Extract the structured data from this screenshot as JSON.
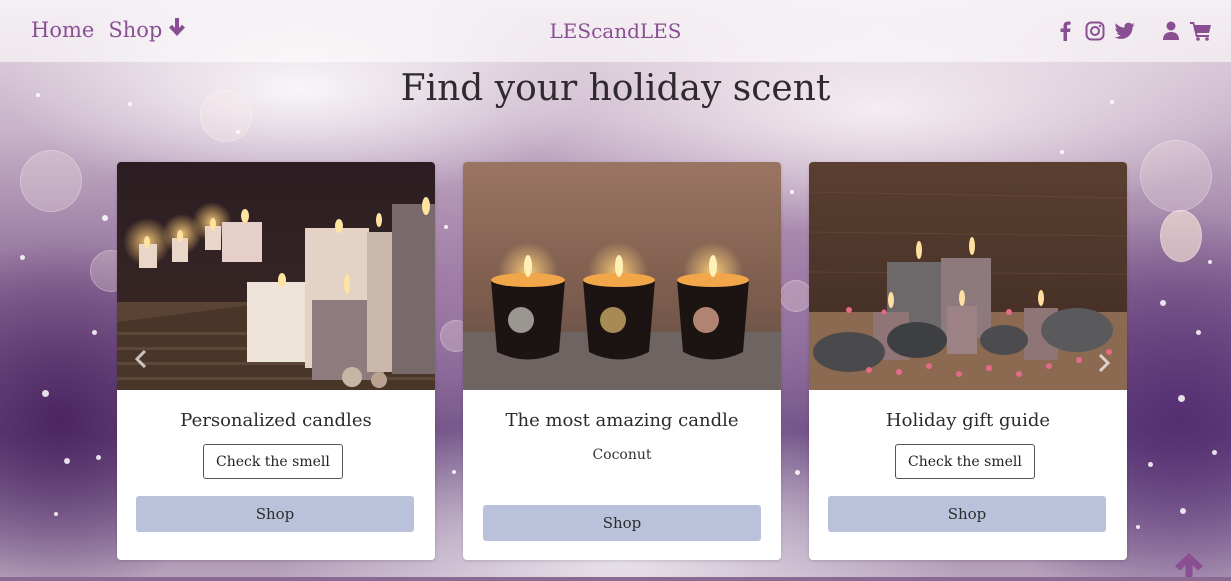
{
  "nav": {
    "home_label": "Home",
    "shop_label": "Shop",
    "brand": "LEScandLES",
    "icons": [
      "facebook-icon",
      "instagram-icon",
      "twitter-icon",
      "user-icon",
      "cart-icon"
    ]
  },
  "hero": {
    "title": "Find your holiday scent"
  },
  "cards": [
    {
      "title": "Personalized candles",
      "smell_button": "Check the smell",
      "shop_button": "Shop"
    },
    {
      "title": "The most amazing candle",
      "subtitle": "Coconut",
      "shop_button": "Shop"
    },
    {
      "title": "Holiday gift guide",
      "smell_button": "Check the smell",
      "shop_button": "Shop"
    }
  ],
  "colors": {
    "accent": "#8a4f93",
    "shop_button": "#b9c2da",
    "heading": "#2f2a2d"
  }
}
